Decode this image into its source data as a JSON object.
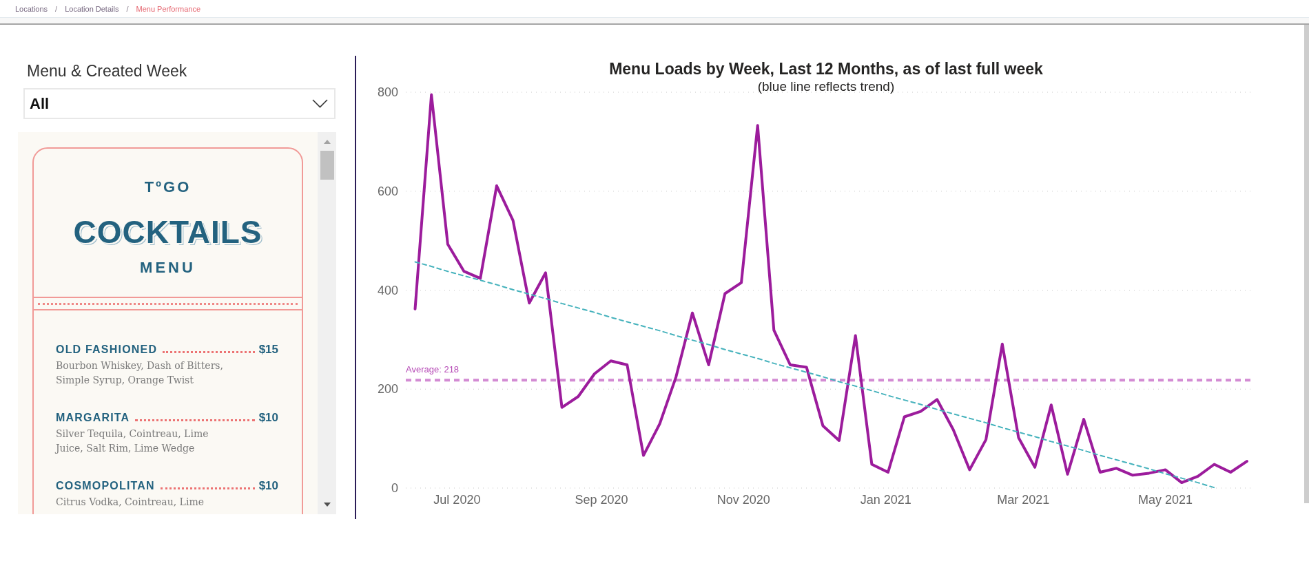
{
  "breadcrumb": {
    "items": [
      {
        "label": "Locations",
        "selected": false
      },
      {
        "label": "Location Details",
        "selected": false
      },
      {
        "label": "Menu Performance",
        "selected": true
      }
    ],
    "separators": [
      "/",
      "/"
    ]
  },
  "slicer": {
    "title": "Menu & Created Week",
    "value": "All"
  },
  "menu_preview": {
    "kicker": "TºGO",
    "title": "COCKTAILS",
    "subtitle": "MENU",
    "items": [
      {
        "name": "OLD FASHIONED",
        "price": "$15",
        "description": "Bourbon Whiskey, Dash of Bitters, Simple Syrup, Orange Twist"
      },
      {
        "name": "MARGARITA",
        "price": "$10",
        "description": "Silver Tequila, Cointreau, Lime Juice, Salt Rim, Lime Wedge"
      },
      {
        "name": "COSMOPOLITAN",
        "price": "$10",
        "description": "Citrus Vodka, Cointreau, Lime"
      }
    ]
  },
  "chart": {
    "subtitle": "(blue line reflects trend)",
    "chart_data": {
      "type": "line",
      "title": "Menu Loads by Week, Last 12 Months, as of last full week",
      "x": [
        "2020-06-13",
        "2020-06-20",
        "2020-06-27",
        "2020-07-04",
        "2020-07-11",
        "2020-07-18",
        "2020-07-25",
        "2020-08-01",
        "2020-08-08",
        "2020-08-15",
        "2020-08-22",
        "2020-08-29",
        "2020-09-05",
        "2020-09-12",
        "2020-09-19",
        "2020-09-26",
        "2020-10-03",
        "2020-10-10",
        "2020-10-17",
        "2020-10-24",
        "2020-10-31",
        "2020-11-07",
        "2020-11-14",
        "2020-11-21",
        "2020-11-28",
        "2020-12-05",
        "2020-12-12",
        "2020-12-19",
        "2020-12-26",
        "2021-01-02",
        "2021-01-09",
        "2021-01-16",
        "2021-01-23",
        "2021-01-30",
        "2021-02-06",
        "2021-02-13",
        "2021-02-20",
        "2021-02-27",
        "2021-03-06",
        "2021-03-13",
        "2021-03-20",
        "2021-03-27",
        "2021-04-03",
        "2021-04-10",
        "2021-04-17",
        "2021-04-24",
        "2021-05-01",
        "2021-05-08",
        "2021-05-15",
        "2021-05-22",
        "2021-05-29",
        "2021-06-05"
      ],
      "series": [
        {
          "color": "#9c1c9c",
          "line_style": "solid",
          "values": [
            362,
            795,
            493,
            438,
            424,
            611,
            541,
            374,
            435,
            163,
            185,
            231,
            257,
            249,
            66,
            130,
            225,
            354,
            249,
            393,
            415,
            733,
            319,
            249,
            244,
            126,
            96,
            308,
            48,
            32,
            144,
            155,
            179,
            118,
            37,
            98,
            291,
            102,
            42,
            168,
            28,
            139,
            32,
            40,
            26,
            30,
            37,
            11,
            24,
            48,
            32,
            54
          ]
        },
        {
          "color": "#45b2bc",
          "line_style": "dashed",
          "values": [
            457,
            448,
            438,
            429,
            420,
            411,
            401,
            392,
            383,
            373,
            364,
            355,
            345,
            336,
            327,
            318,
            308,
            299,
            290,
            280,
            271,
            262,
            252,
            243,
            234,
            225,
            215,
            206,
            197,
            187,
            178,
            169,
            159,
            150,
            141,
            132,
            122,
            113,
            104,
            94,
            85,
            76,
            66,
            57,
            48,
            39,
            29,
            20,
            11,
            1,
            null,
            null
          ]
        }
      ],
      "xlim": [
        "2020-06-09",
        "2021-06-08"
      ],
      "ylim": [
        0,
        800
      ],
      "yticks": [
        0,
        200,
        400,
        600,
        800
      ],
      "xticks": [
        {
          "value": "2020-07-01",
          "label": "Jul 2020"
        },
        {
          "value": "2020-09-01",
          "label": "Sep 2020"
        },
        {
          "value": "2020-11-01",
          "label": "Nov 2020"
        },
        {
          "value": "2021-01-01",
          "label": "Jan 2021"
        },
        {
          "value": "2021-03-01",
          "label": "Mar 2021"
        },
        {
          "value": "2021-05-01",
          "label": "May 2021"
        }
      ],
      "grid": true,
      "ref_lines": [
        {
          "axis": "y",
          "value": 218,
          "label": "Average: 218",
          "color": "#d38bd3"
        }
      ]
    }
  }
}
